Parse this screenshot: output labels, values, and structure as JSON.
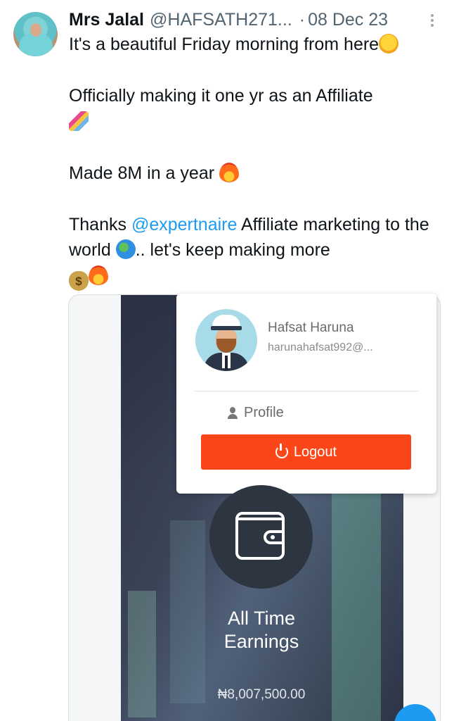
{
  "tweet": {
    "author_name": "Mrs Jalal",
    "handle": "@HAFSATH271...",
    "separator": "·",
    "date": "08 Dec 23",
    "line1": "It's a beautiful Friday morning from here",
    "line2": "Officially making it one yr as an Affiliate",
    "line3": "Made 8M in a year",
    "line4_pre": "Thanks ",
    "mention": "@expertnaire",
    "line4_post": " Affiliate marketing to the world",
    "line4_tail": ".. let's keep making more",
    "emoji_money": "$"
  },
  "popup": {
    "user_name": "Hafsat Haruna",
    "user_email": "harunahafsat992@...",
    "profile_label": "Profile",
    "logout_label": "Logout"
  },
  "earnings": {
    "label_line1": "All Time",
    "label_line2": "Earnings",
    "amount": "₦8,007,500.00"
  },
  "icons": [
    "more-icon",
    "hug-emoji",
    "party-emoji",
    "fire-emoji",
    "globe-emoji",
    "money-bag-emoji",
    "user-icon",
    "power-icon",
    "wallet-icon"
  ],
  "colors": {
    "link": "#1d9bf0",
    "logout": "#fb4619",
    "muted": "#536471"
  }
}
